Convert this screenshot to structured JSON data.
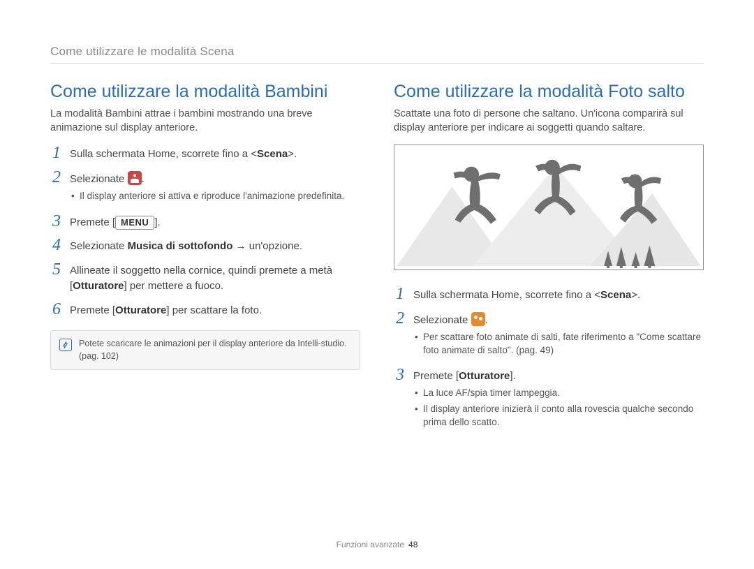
{
  "breadcrumb": "Come utilizzare le modalità Scena",
  "left": {
    "heading": "Come utilizzare la modalità Bambini",
    "intro": "La modalità Bambini attrae i bambini mostrando una breve animazione sul display anteriore.",
    "step1_pre": "Sulla schermata Home, scorrete fino a <",
    "step1_bold": "Scena",
    "step1_post": ">.",
    "step2": "Selezionate ",
    "step2_bullet": "Il display anteriore si attiva e riproduce l'animazione predefinita.",
    "step3_pre": "Premete [",
    "step3_menu": "MENU",
    "step3_post": "].",
    "step4_pre": "Selezionate ",
    "step4_bold": "Musica di sottofondo",
    "step4_post": " → un'opzione.",
    "step5_pre": "Allineate il soggetto nella cornice, quindi premete a metà [",
    "step5_bold": "Otturatore",
    "step5_post": "] per mettere a fuoco.",
    "step6_pre": "Premete [",
    "step6_bold": "Otturatore",
    "step6_post": "] per scattare la foto.",
    "note": "Potete scaricare le animazioni per il display anteriore da Intelli-studio. (pag. 102)"
  },
  "right": {
    "heading": "Come utilizzare la modalità Foto salto",
    "intro": "Scattate una foto di persone che saltano. Un'icona comparirà sul display anteriore per indicare ai soggetti quando saltare.",
    "step1_pre": "Sulla schermata Home, scorrete fino a <",
    "step1_bold": "Scena",
    "step1_post": ">.",
    "step2": "Selezionate ",
    "step2_b1": "Per scattare foto animate di salti, fate riferimento a \"Come scattare foto animate di salto\". (pag. 49)",
    "step3_pre": "Premete [",
    "step3_bold": "Otturatore",
    "step3_post": "].",
    "step3_b1": "La luce AF/spia timer lampeggia.",
    "step3_b2": "Il display anteriore inizierà il conto alla rovescia qualche secondo prima dello scatto."
  },
  "footer_label": "Funzioni avanzate",
  "footer_page": "48",
  "icons": {
    "kids": "kids-mode-icon",
    "jump": "jump-mode-icon"
  }
}
